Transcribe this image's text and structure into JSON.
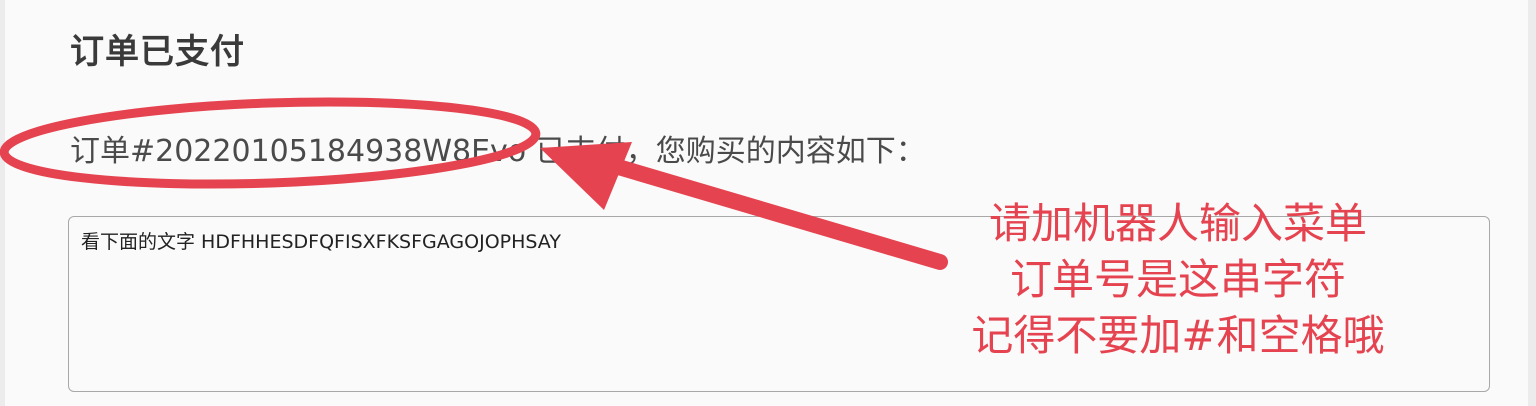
{
  "header": {
    "title": "订单已支付"
  },
  "order": {
    "message": "订单#20220105184938W8Evo 已支付，您购买的内容如下："
  },
  "content": {
    "textarea_value": "看下面的文字 HDFHHESDFQFISXFKSFGAGOJOPHSAY"
  },
  "annotation": {
    "lines": [
      "请加机器人输入菜单",
      "订单号是这串字符",
      "记得不要加#和空格哦"
    ],
    "color": "#e5434f"
  }
}
